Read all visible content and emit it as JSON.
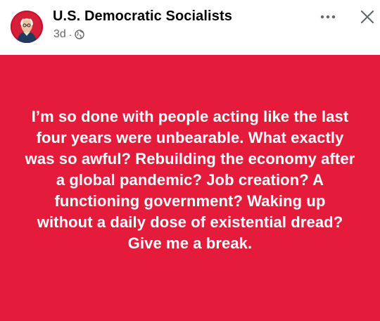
{
  "post": {
    "author": "U.S. Democratic Socialists",
    "time": "3d",
    "separator": "·",
    "audience_icon": "globe-icon",
    "more_icon": "more-horizontal-icon",
    "close_icon": "close-icon",
    "avatar_icon": "portrait-avatar-icon",
    "body_text": "I’m so done with people acting like the last four years were unbearable. What exactly was so awful? Rebuilding the economy after a global pandemic? Job creation? A functioning government? Waking up without a daily dose of existential dread? Give me a break."
  },
  "colors": {
    "card_background": "#e41b3b",
    "card_text": "#ffffff",
    "author_text": "#050505",
    "meta_text": "#65676b",
    "icon_gray": "#65676b"
  }
}
